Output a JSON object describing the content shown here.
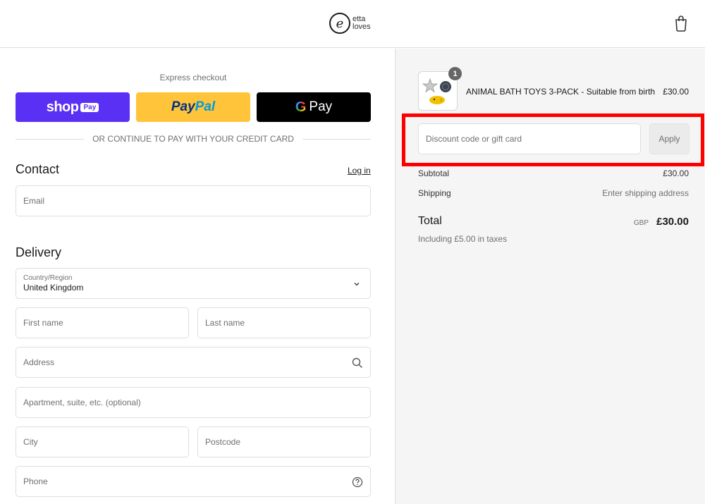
{
  "brand": {
    "logo_line1": "etta",
    "logo_line2": "loves"
  },
  "header": {
    "cart_icon": "shopping-bag-icon"
  },
  "express": {
    "label": "Express checkout",
    "shop_word": "shop",
    "shop_pay": "Pay",
    "paypal_pay": "Pay",
    "paypal_pal": "Pal",
    "gpay_g": "G",
    "gpay_pay": "Pay",
    "divider_text": "OR CONTINUE TO PAY WITH YOUR CREDIT CARD"
  },
  "contact": {
    "title": "Contact",
    "login_label": "Log in",
    "email_placeholder": "Email"
  },
  "delivery": {
    "title": "Delivery",
    "country_label": "Country/Region",
    "country_value": "United Kingdom",
    "first_name_placeholder": "First name",
    "last_name_placeholder": "Last name",
    "address_placeholder": "Address",
    "apartment_placeholder": "Apartment, suite, etc. (optional)",
    "city_placeholder": "City",
    "postcode_placeholder": "Postcode",
    "phone_placeholder": "Phone"
  },
  "order": {
    "item": {
      "quantity": "1",
      "name": "ANIMAL BATH TOYS 3-PACK - Suitable from birth",
      "price": "£30.00"
    },
    "discount_placeholder": "Discount code or gift card",
    "apply_label": "Apply",
    "subtotal_label": "Subtotal",
    "subtotal_value": "£30.00",
    "shipping_label": "Shipping",
    "shipping_value": "Enter shipping address",
    "total_label": "Total",
    "total_currency": "GBP",
    "total_value": "£30.00",
    "tax_note": "Including £5.00 in taxes"
  },
  "colors": {
    "shop_pay": "#5a31f4",
    "paypal": "#ffc439",
    "gpay": "#000000",
    "highlight": "#ff0000",
    "summary_bg": "#f5f5f5"
  }
}
